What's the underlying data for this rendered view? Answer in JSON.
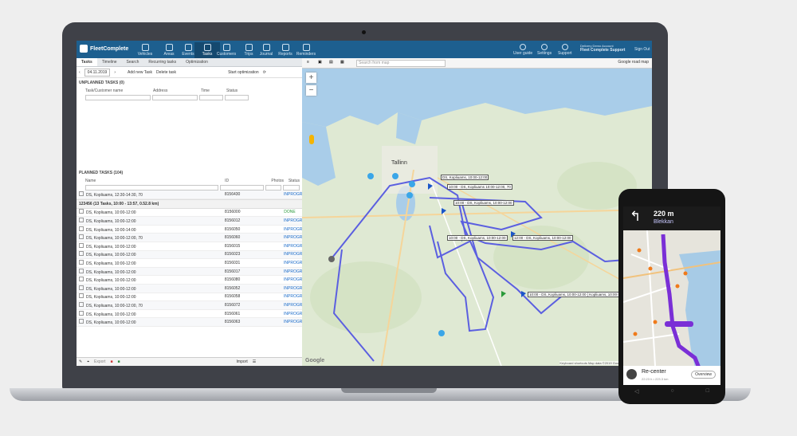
{
  "app": {
    "logo_text": "FleetComplete",
    "nav": [
      "Vehicles",
      "Areas",
      "Events",
      "Tasks",
      "Customers",
      "Trips",
      "Journal",
      "Reports",
      "Reminders"
    ],
    "nav_right": [
      "User guide",
      "Settings",
      "Support"
    ],
    "user": "Fleet Complete Support",
    "user_sub": "Delivery Demo Account",
    "signout": "Sign Out"
  },
  "left": {
    "tabs": [
      "Tasks",
      "Timeline",
      "Search",
      "Recurring tasks",
      "Optimization"
    ],
    "date": "04.11.2019",
    "add_button": "Add new Task",
    "delete_button": "Delete task",
    "start_opt": "Start optimization",
    "unplanned_title": "UNPLANNED TASKS (0)",
    "unplanned_cols": [
      "Task/Customer name",
      "Address",
      "Time",
      "Status"
    ],
    "planned_title": "PLANNED TASKS (104)",
    "planned_cols": [
      "Name",
      "ID",
      "Photos",
      "Status"
    ],
    "rows_top": [
      {
        "name": "DS, Kopliuams, 12:30-14:30, 70",
        "id": "8156430",
        "status": "INPROGR"
      }
    ],
    "group_label": "123456 (13 Tasks, 10:00 - 13:57, 0.52.8 km)",
    "rows": [
      {
        "name": "DS, Kopliuams, 10:00-12:00",
        "id": "8156000",
        "status": "DONE"
      },
      {
        "name": "DS, Kopliuams, 10:00-12:00",
        "id": "8156012",
        "status": "INPROGR"
      },
      {
        "name": "DS, Kopliuams, 10:00-14:00",
        "id": "8156050",
        "status": "INPROGR"
      },
      {
        "name": "DS, Kopliuams, 10:00-12:00, 70",
        "id": "8156060",
        "status": "INPROGR"
      },
      {
        "name": "DS, Kopliuams, 10:00-12:00",
        "id": "8156015",
        "status": "INPROGR"
      },
      {
        "name": "DS, Kopliuams, 10:00-12:00",
        "id": "8156023",
        "status": "INPROGR"
      },
      {
        "name": "DS, Kopliuams, 10:00-12:00",
        "id": "8156031",
        "status": "INPROGR"
      },
      {
        "name": "DS, Kopliuams, 10:00-12:00",
        "id": "8156017",
        "status": "INPROGR"
      },
      {
        "name": "DS, Kopliuams, 10:00-12:00",
        "id": "8156080",
        "status": "INPROGR"
      },
      {
        "name": "DS, Kopliuams, 10:00-12:00",
        "id": "8156052",
        "status": "INPROGR"
      },
      {
        "name": "DS, Kopliuams, 10:00-12:00",
        "id": "8156058",
        "status": "INPROGR"
      },
      {
        "name": "DS, Kopliuams, 10:00-12:00, 70",
        "id": "8156072",
        "status": "INPROGR"
      },
      {
        "name": "DS, Kopliuams, 10:00-12:00",
        "id": "8156061",
        "status": "INPROGR"
      },
      {
        "name": "DS, Kopliuams, 10:00-12:00",
        "id": "8156063",
        "status": "INPROGR"
      }
    ],
    "footer_export": "Export",
    "footer_import": "Import"
  },
  "map": {
    "search_placeholder": "Search from map",
    "map_type": "Google road map",
    "city": "Tallinn",
    "labels": [
      "DS, Kopliuams, 10:00-12:00",
      "10:00 - DS, Kopliuams 10:00-12:00, 70",
      "10:00 - DS, Kopliuams, 10:00-12:00",
      "10:00 - DS, Kopliuams, 10:00-12:00 | Kopliuams, 10:00-12:00",
      "12:00 - DS, Kopliuams, 10:00-12:00",
      "10:00 - DS, Kopliuams, 10:00-12:00"
    ],
    "google": "Google",
    "attribution": "Keyboard shortcuts  Map data ©2019 Google  2 km  Terms of Use"
  },
  "phone": {
    "distance": "220 m",
    "street": "Blekkan",
    "recenter": "Re-center",
    "sub": "22:23 h • 223.3 km",
    "overview": "Overview"
  },
  "colors": {
    "nav": "#1d5f8f",
    "route": "#5b5fe0",
    "phone_route": "#7a2fd6"
  }
}
